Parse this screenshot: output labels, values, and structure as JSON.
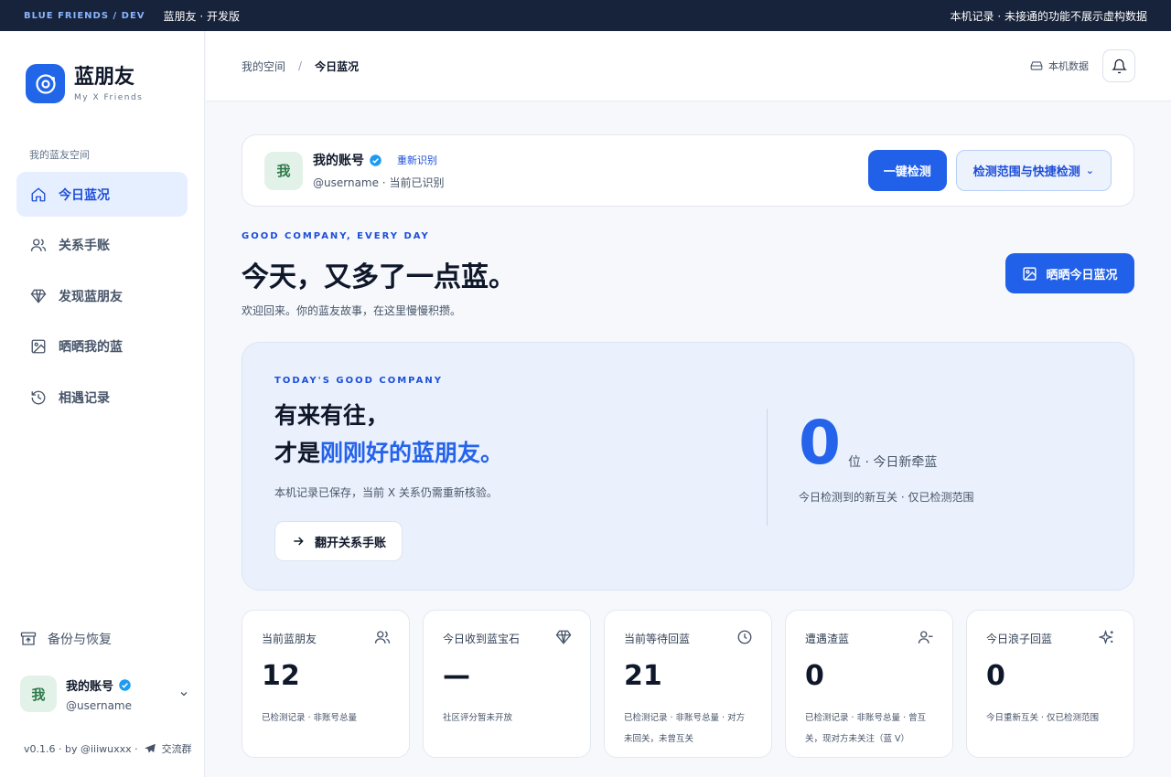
{
  "topbar": {
    "tag": "BLUE FRIENDS / DEV",
    "title": "蓝朋友 · 开发版",
    "note": "本机记录 · 未接通的功能不展示虚构数据"
  },
  "brand": {
    "name": "蓝朋友",
    "subtitle": "My X Friends",
    "accent": "#2166e8"
  },
  "sidebar": {
    "section": "我的蓝友空间",
    "items": [
      {
        "label": "今日蓝况",
        "icon": "home-icon",
        "active": true
      },
      {
        "label": "关系手账",
        "icon": "users-icon"
      },
      {
        "label": "发现蓝朋友",
        "icon": "diamond-icon"
      },
      {
        "label": "晒晒我的蓝",
        "icon": "image-icon"
      },
      {
        "label": "相遇记录",
        "icon": "history-icon"
      }
    ],
    "backup": "备份与恢复",
    "user": {
      "avatar": "我",
      "name": "我的账号",
      "handle": "@username"
    },
    "footer": {
      "version": "v0.1.6 · by @iiiwuxxx ·",
      "group": "交流群"
    }
  },
  "header": {
    "crumb_root": "我的空间",
    "crumb_sep": "/",
    "crumb_current": "今日蓝况",
    "local_data": "本机数据"
  },
  "account": {
    "avatar": "我",
    "name": "我的账号",
    "relink": "重新识别",
    "sub": "@username · 当前已识别",
    "detect": "一键检测",
    "scope": "检测范围与快捷检测",
    "scope_caret": "⌄"
  },
  "intro": {
    "eyebrow": "GOOD COMPANY, EVERY DAY",
    "headline": "今天，又多了一点蓝。",
    "subline": "欢迎回来。你的蓝友故事，在这里慢慢积攒。",
    "share": "晒晒今日蓝况"
  },
  "hero": {
    "eyebrow": "TODAY'S GOOD COMPANY",
    "line1": "有来有往，",
    "line2_prefix": "才是",
    "line2_accent": "刚刚好的蓝朋友。",
    "note": "本机记录已保存，当前 X 关系仍需重新核验。",
    "button": "翻开关系手账",
    "count": "0",
    "unit": "位 · 今日新牵蓝",
    "count_note": "今日检测到的新互关 · 仅已检测范围"
  },
  "stats": [
    {
      "label": "当前蓝朋友",
      "icon": "users-icon",
      "value": "12",
      "note": "已检测记录 · 非账号总量"
    },
    {
      "label": "今日收到蓝宝石",
      "icon": "diamond-icon",
      "value": "—",
      "note": "社区评分暂未开放"
    },
    {
      "label": "当前等待回蓝",
      "icon": "clock-icon",
      "value": "21",
      "note": "已检测记录 · 非账号总量 · 对方未回关，未曾互关"
    },
    {
      "label": "遭遇渣蓝",
      "icon": "user-minus-icon",
      "value": "0",
      "note": "已检测记录 · 非账号总量 · 曾互关，现对方未关注（蓝 V）"
    },
    {
      "label": "今日浪子回蓝",
      "icon": "sparkles-icon",
      "value": "0",
      "note": "今日重新互关 · 仅已检测范围"
    }
  ]
}
